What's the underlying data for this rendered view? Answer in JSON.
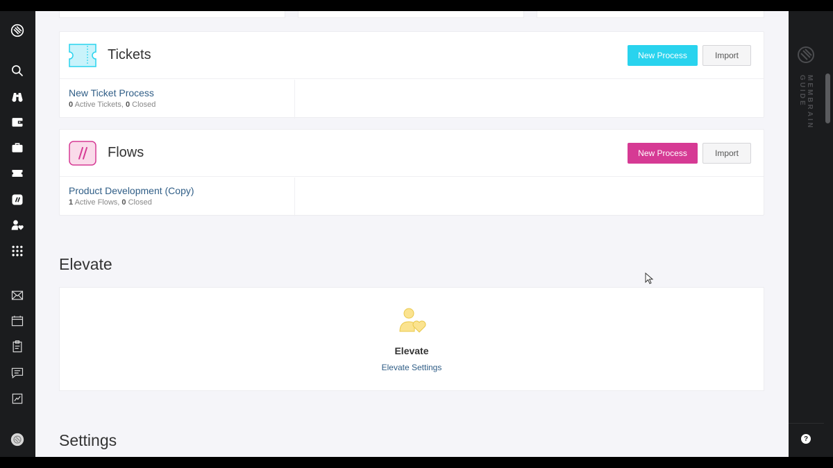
{
  "tickets": {
    "title": "Tickets",
    "new_process_label": "New Process",
    "import_label": "Import",
    "process_name": "New Ticket Process",
    "active_count": "0",
    "active_text": " Active Tickets, ",
    "closed_count": "0",
    "closed_text": " Closed",
    "accent_color": "#29d3ee"
  },
  "flows": {
    "title": "Flows",
    "new_process_label": "New Process",
    "import_label": "Import",
    "process_name": "Product Development (Copy)",
    "active_count": "1",
    "active_text": " Active Flows, ",
    "closed_count": "0",
    "closed_text": " Closed",
    "accent_color": "#d63a94"
  },
  "elevate_section": {
    "heading": "Elevate",
    "card_title": "Elevate",
    "settings_link": "Elevate Settings"
  },
  "settings_section": {
    "heading": "Settings"
  },
  "right_panel": {
    "guide_label": "MEMBRAIN GUIDE",
    "help_label": "?"
  },
  "sidebar": {
    "items": [
      "logo-icon",
      "search-icon",
      "binoculars-icon",
      "wallet-icon",
      "briefcase-icon",
      "ticket-icon",
      "flows-icon",
      "user-heart-icon",
      "apps-grid-icon",
      "mail-icon",
      "calendar-icon",
      "clipboard-icon",
      "chat-icon",
      "report-icon",
      "avatar"
    ]
  }
}
